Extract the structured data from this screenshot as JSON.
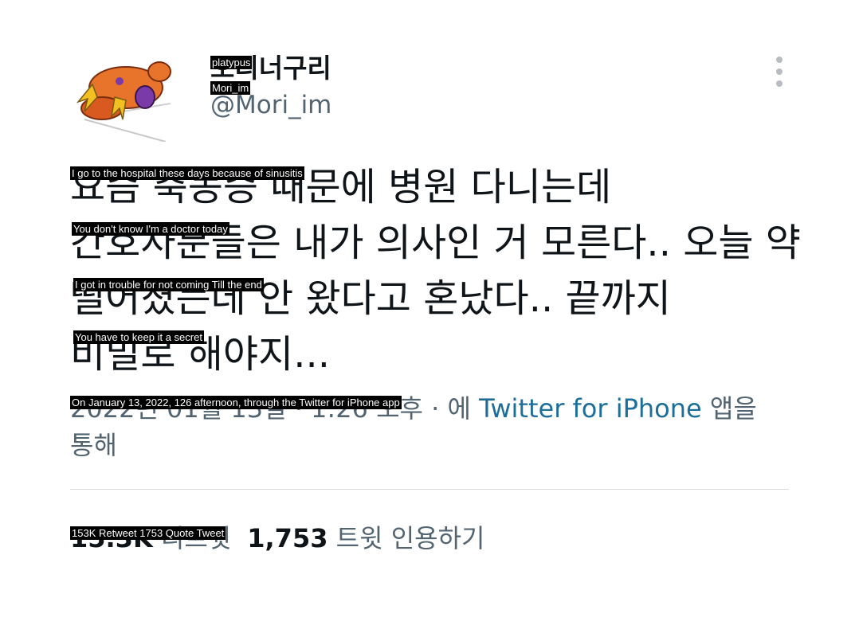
{
  "user": {
    "display_name": "오리너구리",
    "handle": "@Mori_im"
  },
  "tweet": {
    "lines": [
      "요즘 축농증 때문에 병원 다니는데",
      "간호사분들은 내가 의사인 거 모른다.. 오늘 약",
      "떨어졌는데 안 왔다고 혼났다.. 끝까지",
      "비밀로 해야지..."
    ]
  },
  "meta": {
    "date_prefix": "2022년 01월 13일 · 1:26 오후 · 에 ",
    "source": "Twitter for iPhone",
    "source_suffix": " 앱을",
    "line2": "통해"
  },
  "stats": {
    "retweets_count": "15.3K",
    "retweets_label": "리트윗",
    "quotes_count": "1,753",
    "quotes_label": "트윗 인용하기"
  },
  "translations": {
    "name": "platypus",
    "handle": "Mori_im",
    "line1": "I go to the hospital these days because of sinusitis",
    "line2": "You don't know I'm a doctor today",
    "line3": "I got in trouble for not coming Till the end",
    "line4": "You have to keep it a secret",
    "meta": "On January 13, 2022, 126 afternoon, through the Twitter for iPhone app",
    "stats": "153K Retweet 1753 Quote Tweet"
  },
  "colors": {
    "text_primary": "#0f1419",
    "text_secondary": "#536471",
    "link": "#1d6f9a",
    "divider": "#d7dce0"
  },
  "icons": {
    "more": "more-vertical-icon",
    "avatar": "platypus-avatar"
  }
}
